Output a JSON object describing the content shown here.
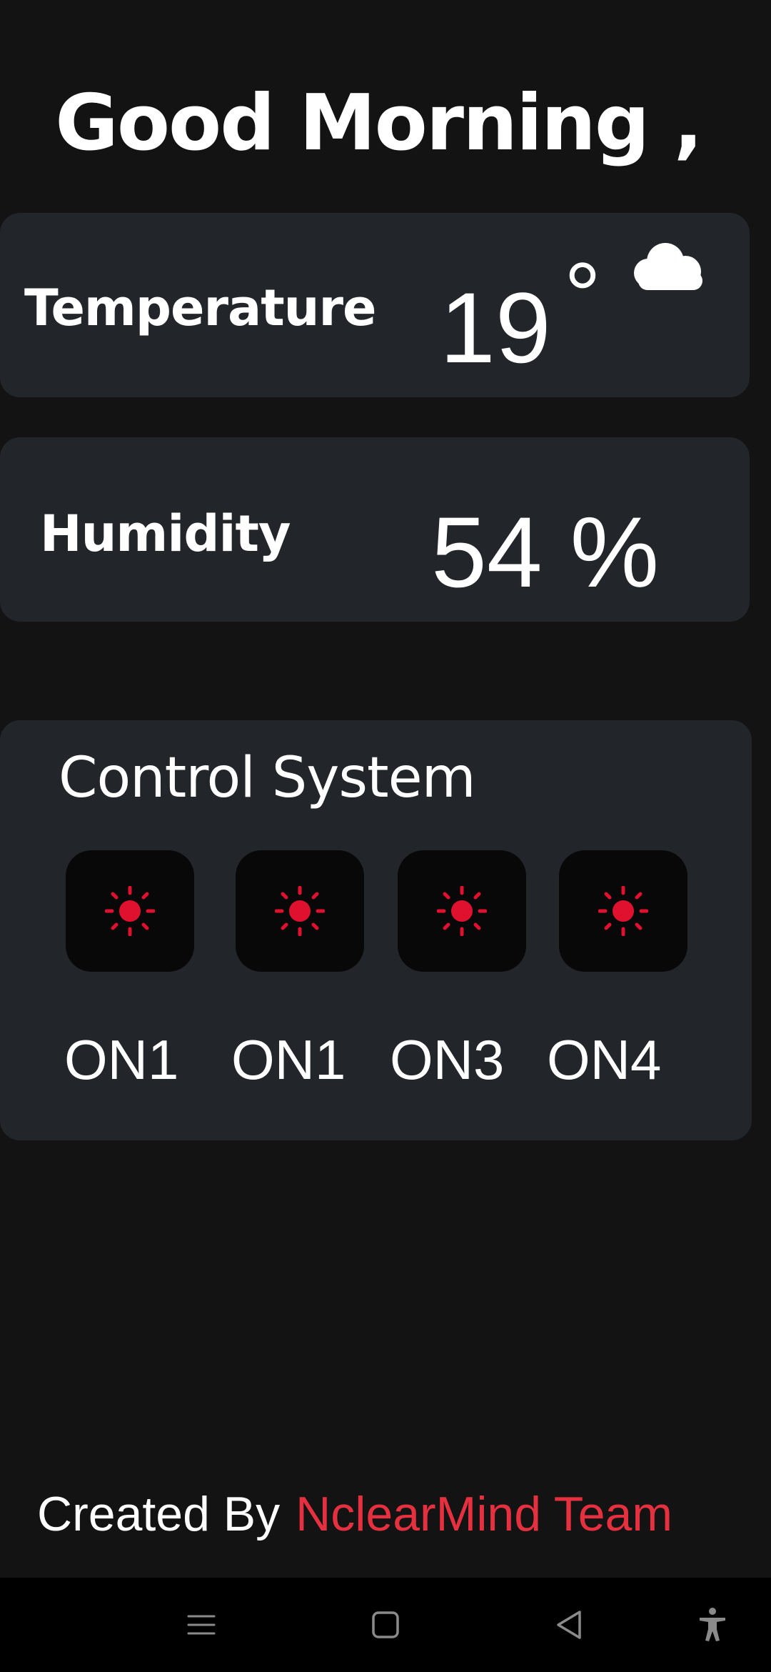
{
  "greeting": "Good Morning ,",
  "temperature": {
    "label": "Temperature",
    "value": "19",
    "unit": "°",
    "weather_icon": "cloud-icon"
  },
  "humidity": {
    "label": "Humidity",
    "value": "54 %"
  },
  "control": {
    "title": "Control System",
    "switches": [
      {
        "icon": "sun-icon",
        "label": "ON1"
      },
      {
        "icon": "sun-icon",
        "label": "ON1"
      },
      {
        "icon": "sun-icon",
        "label": "ON3"
      },
      {
        "icon": "sun-icon",
        "label": "ON4"
      }
    ]
  },
  "footer": {
    "prefix": "Created By",
    "team": "NclearMind Team"
  },
  "nav": {
    "items": [
      "menu-icon",
      "home-icon",
      "back-icon",
      "accessibility-icon"
    ]
  },
  "colors": {
    "background": "#131313",
    "card": "#22252a",
    "switch_bg": "#080808",
    "accent_red": "#e5303f",
    "sun_red": "#e0102f",
    "navbar": "#000000"
  }
}
